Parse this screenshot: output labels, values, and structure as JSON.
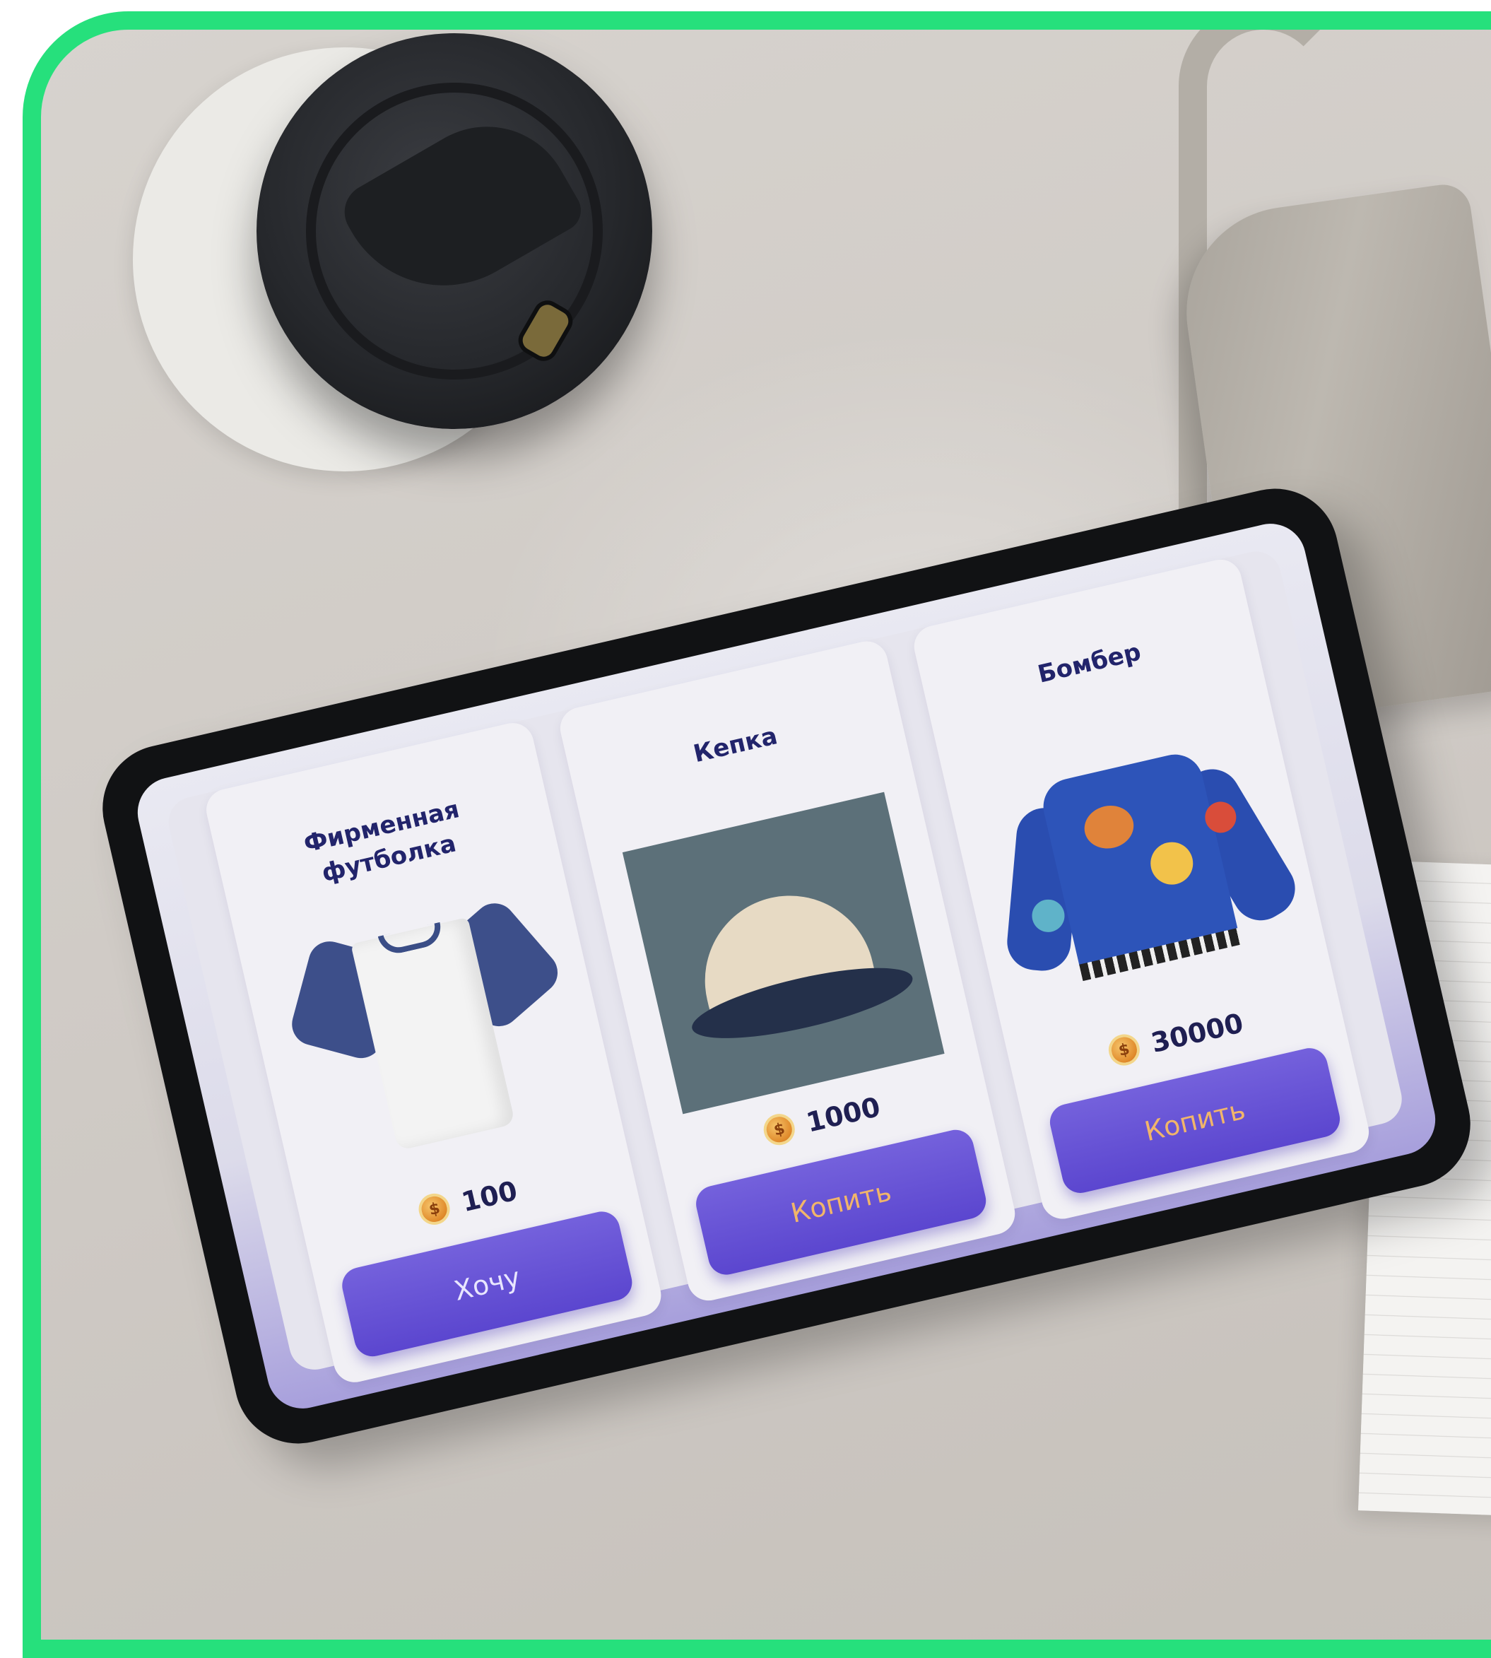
{
  "products": [
    {
      "name": "Фирменная\nфутболка",
      "price": "100",
      "action_label": "Хочу",
      "image_icon": "t-shirt-image"
    },
    {
      "name": "Кепка",
      "price": "1000",
      "action_label": "Копить",
      "image_icon": "cap-image"
    },
    {
      "name": "Бомбер",
      "price": "30000",
      "action_label": "Копить",
      "image_icon": "bomber-jacket-image"
    }
  ],
  "currency_icon": "coin-icon",
  "coin_glyph": "$",
  "colors": {
    "frame_accent": "#26e07c",
    "button": "#5b46cf",
    "button_text_save": "#f1b56a",
    "title_text": "#22246b"
  }
}
